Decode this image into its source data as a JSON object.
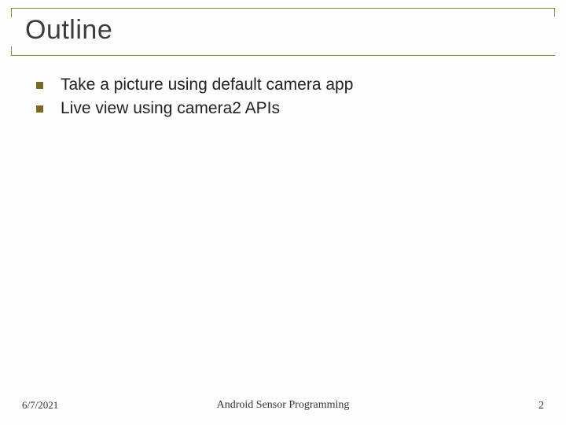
{
  "title": "Outline",
  "bullets": [
    "Take a picture using default camera app",
    "Live view using camera2 APIs"
  ],
  "footer": {
    "date": "6/7/2021",
    "center": "Android Sensor Programming",
    "page": "2"
  }
}
